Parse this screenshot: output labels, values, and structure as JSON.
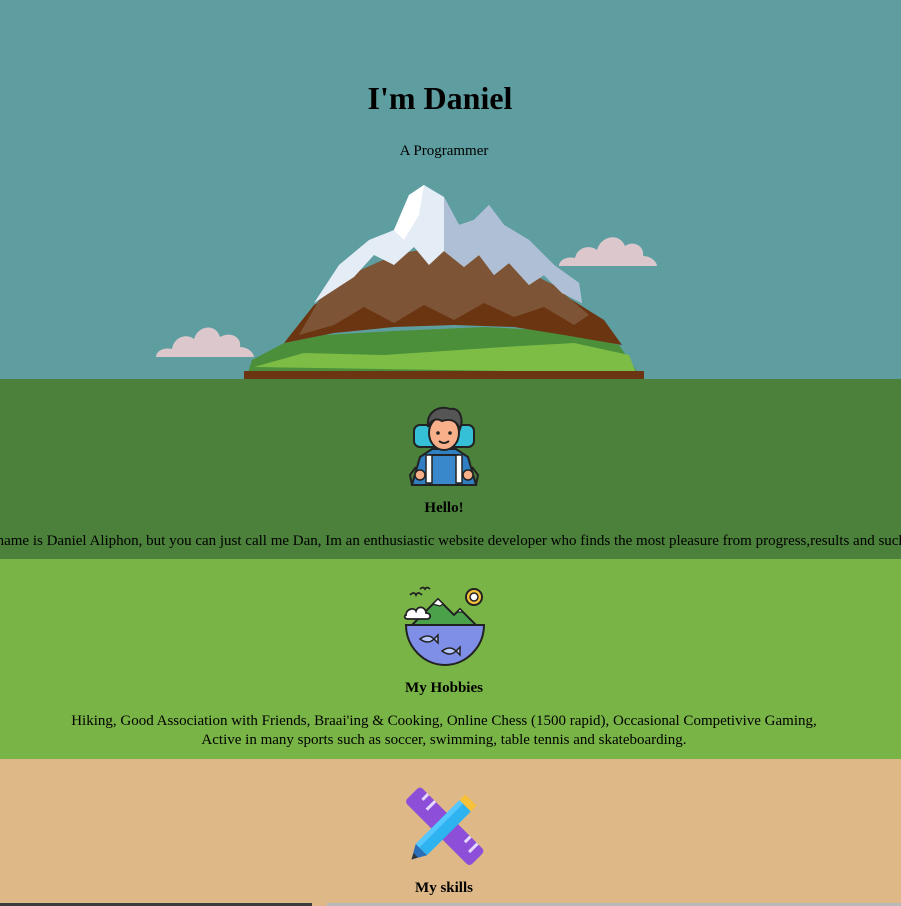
{
  "hero": {
    "title": "I'm Daniel",
    "subtitle": "A Programmer",
    "background": "#5f9ea0",
    "illustration": "mountain-icon"
  },
  "about": {
    "heading": "Hello!",
    "text": "My name is Daniel Aliphon, but you can just call me Dan, Im an enthusiastic website developer who finds the most pleasure from progress,results and such.",
    "icon": "hiker-avatar-icon",
    "background": "#4b813b"
  },
  "hobbies": {
    "heading": "My Hobbies",
    "line1": "Hiking, Good Association with Friends, Braai'ing & Cooking, Online Chess (1500 rapid), Occasional Competivive Gaming,",
    "line2": "Active in many sports such as soccer, swimming, table tennis and skateboarding.",
    "icon": "nature-globe-icon",
    "background": "#79b546"
  },
  "skills": {
    "heading": "My skills",
    "icon": "ruler-pencil-icon",
    "background": "#deb887"
  }
}
